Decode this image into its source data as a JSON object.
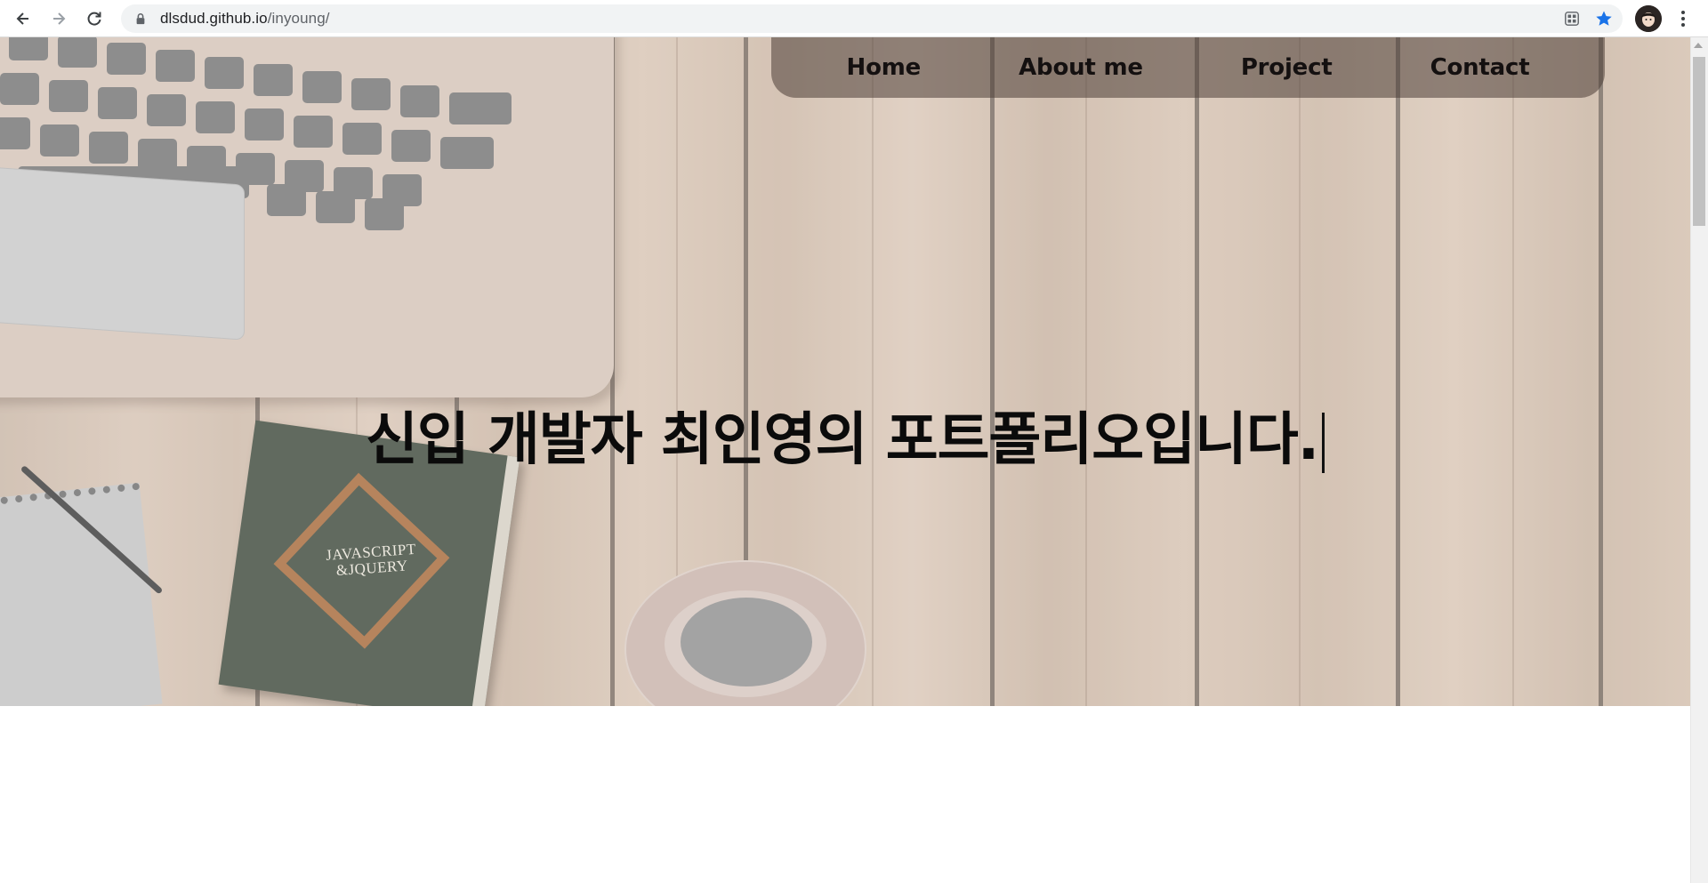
{
  "browser": {
    "url_host": "dlsdud.github.io",
    "url_path": "/inyoung/",
    "icons": {
      "back": "arrow-left-icon",
      "forward": "arrow-right-icon",
      "reload": "reload-icon",
      "lock": "lock-icon",
      "qr": "qr-code-icon",
      "bookmark": "star-icon",
      "profile": "avatar",
      "menu": "more-vertical-icon"
    },
    "colors": {
      "bookmark_star": "#1a73e8"
    }
  },
  "nav": {
    "items": [
      {
        "label": "Home"
      },
      {
        "label": "About me"
      },
      {
        "label": "Project"
      },
      {
        "label": "Contact"
      }
    ]
  },
  "hero": {
    "title": "신입 개발자 최인영의 포트폴리오입니다.",
    "book_title_line1": "JAVASCRIPT",
    "book_title_line2": "&JQUERY",
    "background": "wooden-desk-image"
  }
}
